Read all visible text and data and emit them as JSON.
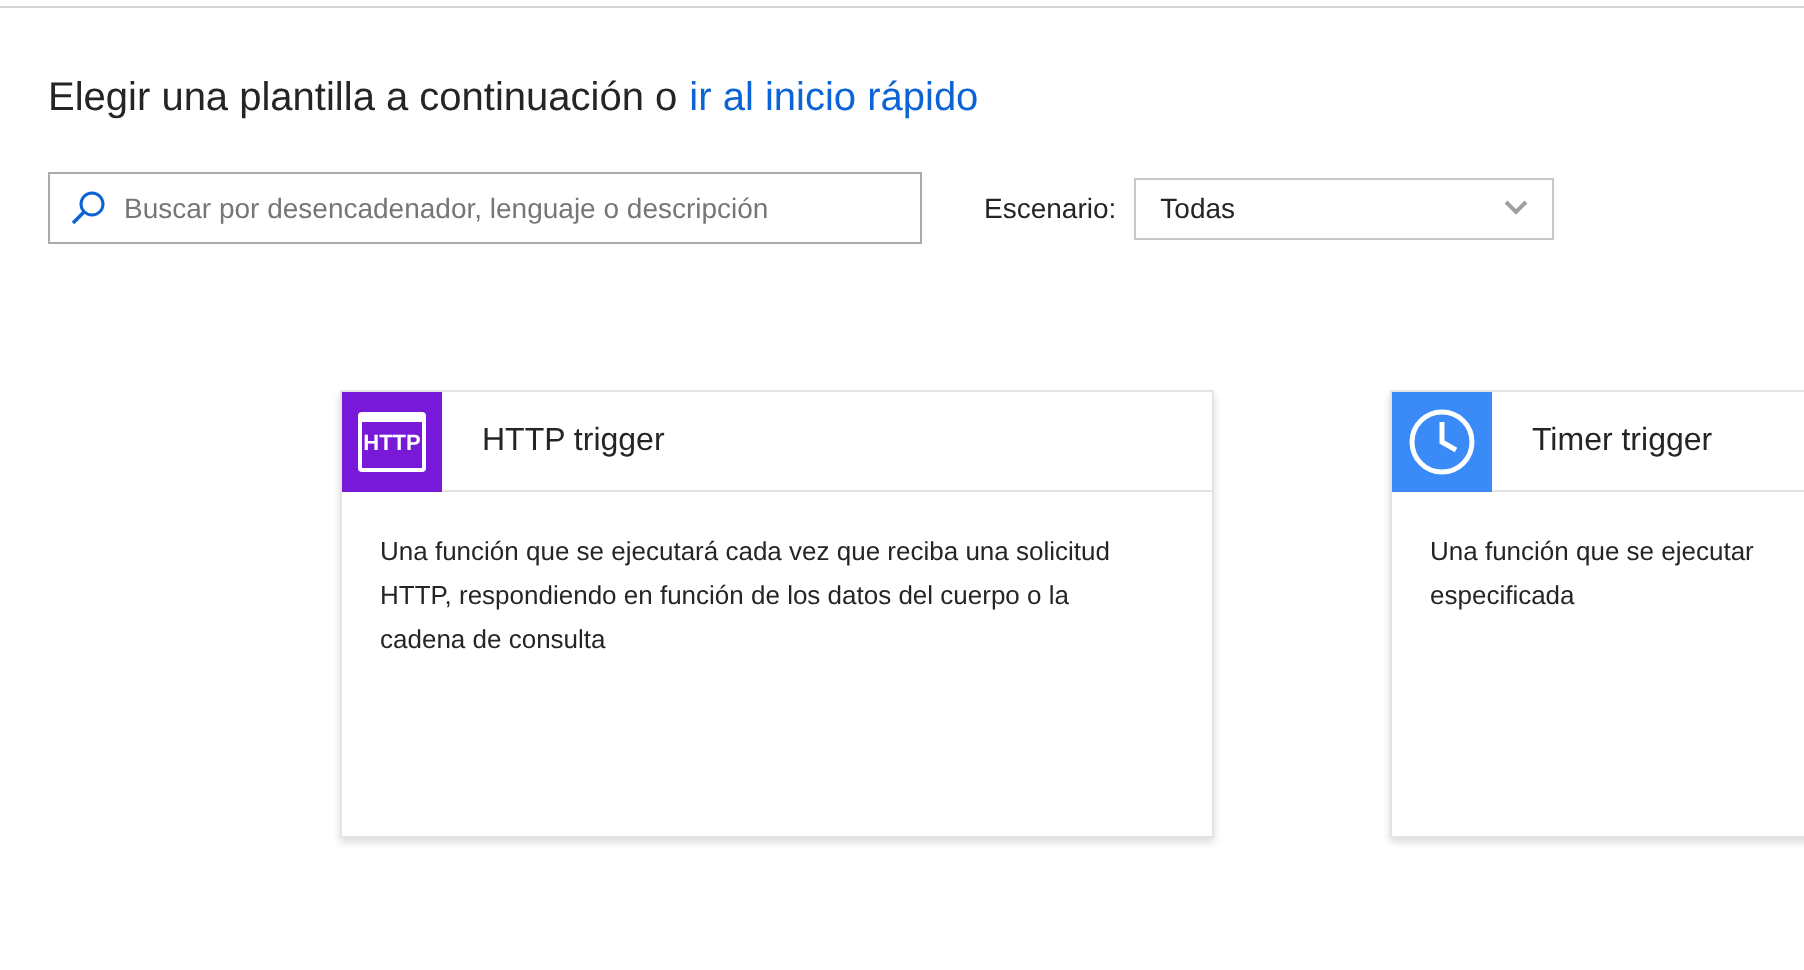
{
  "heading": {
    "text": "Elegir una plantilla a continuación o",
    "link": "ir al inicio rápido"
  },
  "search": {
    "placeholder": "Buscar por desencadenador, lenguaje o descripción"
  },
  "scenario": {
    "label": "Escenario:",
    "value": "Todas"
  },
  "templates": [
    {
      "kind": "http",
      "title": "HTTP trigger",
      "icon_text": "HTTP",
      "color": "#7719d6",
      "description": "Una función que se ejecutará cada vez que reciba una solicitud HTTP, respondiendo en función de los datos del cuerpo o la cadena de consulta"
    },
    {
      "kind": "timer",
      "title": "Timer trigger",
      "color": "#3a8bf8",
      "description": "Una función que se ejecutar especificada"
    }
  ]
}
